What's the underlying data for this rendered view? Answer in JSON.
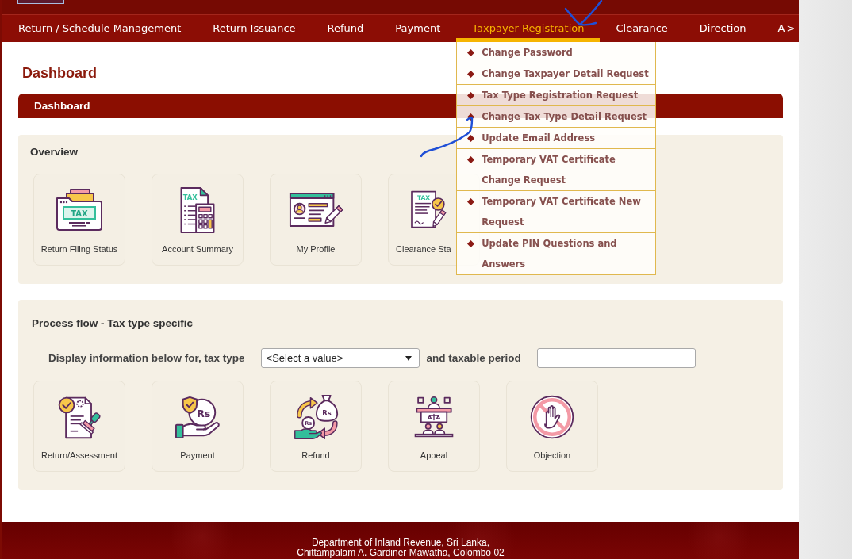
{
  "nav": {
    "items": [
      {
        "label": "Return / Schedule Management",
        "selected": false,
        "expanded": false
      },
      {
        "label": "Return Issuance",
        "selected": false,
        "expanded": false
      },
      {
        "label": "Refund",
        "selected": false,
        "expanded": false
      },
      {
        "label": "Payment",
        "selected": false,
        "expanded": false
      },
      {
        "label": "Taxpayer Registration",
        "selected": true,
        "expanded": true,
        "menu": [
          "Change Password",
          "Change Taxpayer Detail Request",
          "Tax Type Registration Request",
          "Change Tax Type Detail Request",
          "Update Email Address",
          "Temporary VAT Certificate Change Request",
          "Temporary VAT Certificate New Request",
          "Update PIN Questions and Answers"
        ]
      },
      {
        "label": "Clearance",
        "selected": false,
        "expanded": false
      },
      {
        "label": "Direction",
        "selected": false,
        "expanded": false
      },
      {
        "label": "A",
        "selected": false,
        "expanded": false
      }
    ],
    "scroll_button": ">"
  },
  "page_title": "Dashboard",
  "dashboard_bar": {
    "title": "Dashboard"
  },
  "overview": {
    "title": "Overview",
    "tiles": [
      {
        "label": "Return Filing Status",
        "icon_texts": [
          "TAX"
        ]
      },
      {
        "label": "Account Summary",
        "icon_texts": [
          "TAX"
        ]
      },
      {
        "label": "My Profile"
      },
      {
        "label": "Clearance Sta",
        "icon_texts": [
          "TAX"
        ]
      }
    ]
  },
  "process_flow": {
    "title": "Process flow - Tax type specific",
    "tax_type_label": "Display information below for, tax type",
    "tax_type_select": {
      "value": "<Select a value>"
    },
    "period_label": "and taxable period",
    "tiles": [
      {
        "label": "Return/Assessment"
      },
      {
        "label": "Payment",
        "icon_texts": [
          "Rs"
        ]
      },
      {
        "label": "Refund",
        "icon_texts": [
          "Rs",
          "Rs"
        ]
      },
      {
        "label": "Appeal"
      },
      {
        "label": "Objection"
      }
    ]
  },
  "footer": {
    "lines": [
      "Department of Inland Revenue, Sri Lanka,",
      "Chittampalam A. Gardiner Mawatha, Colombo 02"
    ]
  }
}
